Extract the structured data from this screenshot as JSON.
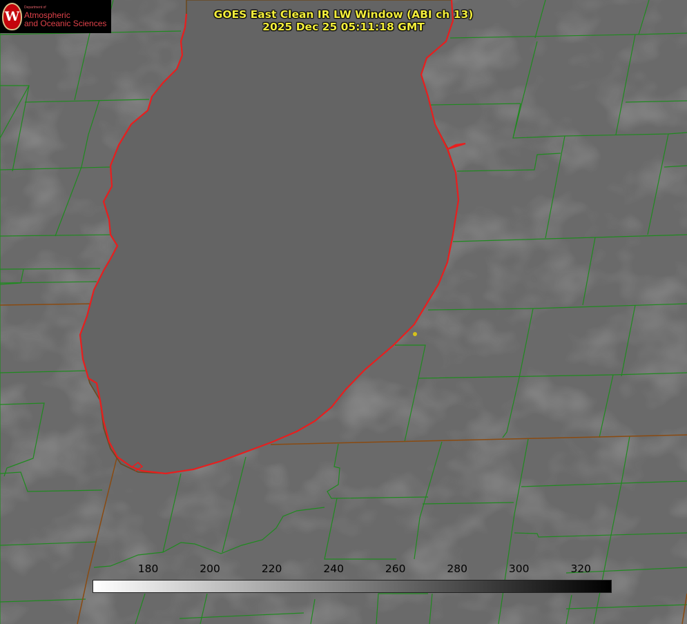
{
  "title": {
    "line1": "GOES East Clean IR LW Window (ABI ch 13)",
    "line2": "2025 Dec 25 05:11:18 GMT"
  },
  "logo": {
    "department": "Department of",
    "line1": "Atmospheric",
    "line2": "and Oceanic Sciences"
  },
  "colorbar": {
    "min": 162,
    "max": 330,
    "ticks": [
      {
        "value": 180,
        "label": "180"
      },
      {
        "value": 200,
        "label": "200"
      },
      {
        "value": 220,
        "label": "220"
      },
      {
        "value": 240,
        "label": "240"
      },
      {
        "value": 260,
        "label": "260"
      },
      {
        "value": 280,
        "label": "280"
      },
      {
        "value": 300,
        "label": "300"
      },
      {
        "value": 320,
        "label": "320"
      }
    ],
    "colors": {
      "low": "#ffffff",
      "high": "#000000"
    }
  },
  "colors": {
    "lake": "#646464",
    "land": "#6a6a6a",
    "county_border": "#1f8a1f",
    "state_border": "#8a4a10",
    "lake_outline": "#e81e1e",
    "point_marker": "#d6c21a",
    "title_text": "#f3ee3c"
  },
  "icons": {
    "logo": "uw-madison-crest-icon",
    "marker": "city-dot-icon"
  }
}
